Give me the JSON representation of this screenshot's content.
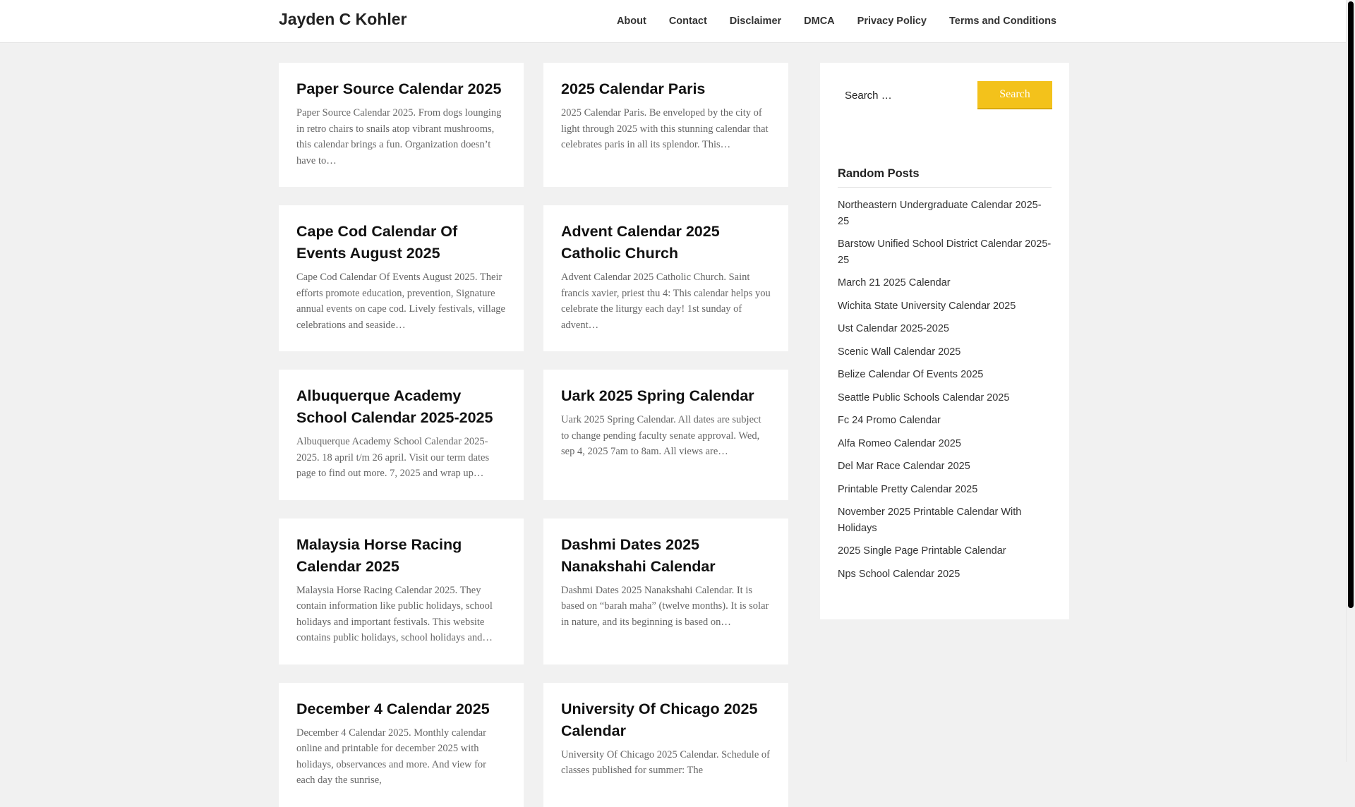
{
  "header": {
    "site_title": "Jayden C Kohler",
    "nav": [
      "About",
      "Contact",
      "Disclaimer",
      "DMCA",
      "Privacy Policy",
      "Terms and Conditions"
    ]
  },
  "posts": [
    {
      "title": "Paper Source Calendar 2025",
      "excerpt": "Paper Source Calendar 2025. From dogs lounging in retro chairs to snails atop vibrant mushrooms, this calendar brings a fun. Organization doesn’t have to…"
    },
    {
      "title": "2025 Calendar Paris",
      "excerpt": "2025 Calendar Paris. Be enveloped by the city of light through 2025 with this stunning calendar that celebrates paris in all its splendor. This…"
    },
    {
      "title": "Cape Cod Calendar Of Events August 2025",
      "excerpt": "Cape Cod Calendar Of Events August 2025. Their efforts promote education, prevention, Signature annual events on cape cod. Lively festivals, village celebrations and seaside…"
    },
    {
      "title": "Advent Calendar 2025 Catholic Church",
      "excerpt": "Advent Calendar 2025 Catholic Church. Saint francis xavier, priest thu 4: This calendar helps you celebrate the liturgy each day! 1st sunday of advent…"
    },
    {
      "title": "Albuquerque Academy School Calendar 2025-2025",
      "excerpt": "Albuquerque Academy School Calendar 2025-2025. 18 april t/m 26 april. Visit our term dates page to find out more. 7, 2025 and wrap up…"
    },
    {
      "title": "Uark 2025 Spring Calendar",
      "excerpt": "Uark 2025 Spring Calendar. All dates are subject to change pending faculty senate approval. Wed, sep 4, 2025 7am to 8am. All views are…"
    },
    {
      "title": "Malaysia Horse Racing Calendar 2025",
      "excerpt": "Malaysia Horse Racing Calendar 2025. They contain information like public holidays, school holidays and important festivals. This website contains public holidays, school holidays and…"
    },
    {
      "title": "Dashmi Dates 2025 Nanakshahi Calendar",
      "excerpt": "Dashmi Dates 2025 Nanakshahi Calendar. It is based on “barah maha” (twelve months). It is solar in nature, and its beginning is based on…"
    },
    {
      "title": "December 4 Calendar 2025",
      "excerpt": "December 4 Calendar 2025. Monthly calendar online and printable for december 2025 with holidays, observances and more. And view for each day the sunrise,"
    },
    {
      "title": "University Of Chicago 2025 Calendar",
      "excerpt": "University Of Chicago 2025 Calendar. Schedule of classes published for summer: The"
    }
  ],
  "sidebar": {
    "search_placeholder": "Search …",
    "search_button": "Search",
    "widget_title": "Random Posts",
    "random_posts": [
      "Northeastern Undergraduate Calendar 2025-25",
      "Barstow Unified School District Calendar 2025-25",
      "March 21 2025 Calendar",
      "Wichita State University Calendar 2025",
      "Ust Calendar 2025-2025",
      "Scenic Wall Calendar 2025",
      "Belize Calendar Of Events 2025",
      "Seattle Public Schools Calendar 2025",
      "Fc 24 Promo Calendar",
      "Alfa Romeo Calendar 2025",
      "Del Mar Race Calendar 2025",
      "Printable Pretty Calendar 2025",
      "November 2025 Printable Calendar With Holidays",
      "2025 Single Page Printable Calendar",
      "Nps School Calendar 2025"
    ]
  },
  "colors": {
    "accent": "#f3c21b",
    "background": "#f1f1f1"
  }
}
